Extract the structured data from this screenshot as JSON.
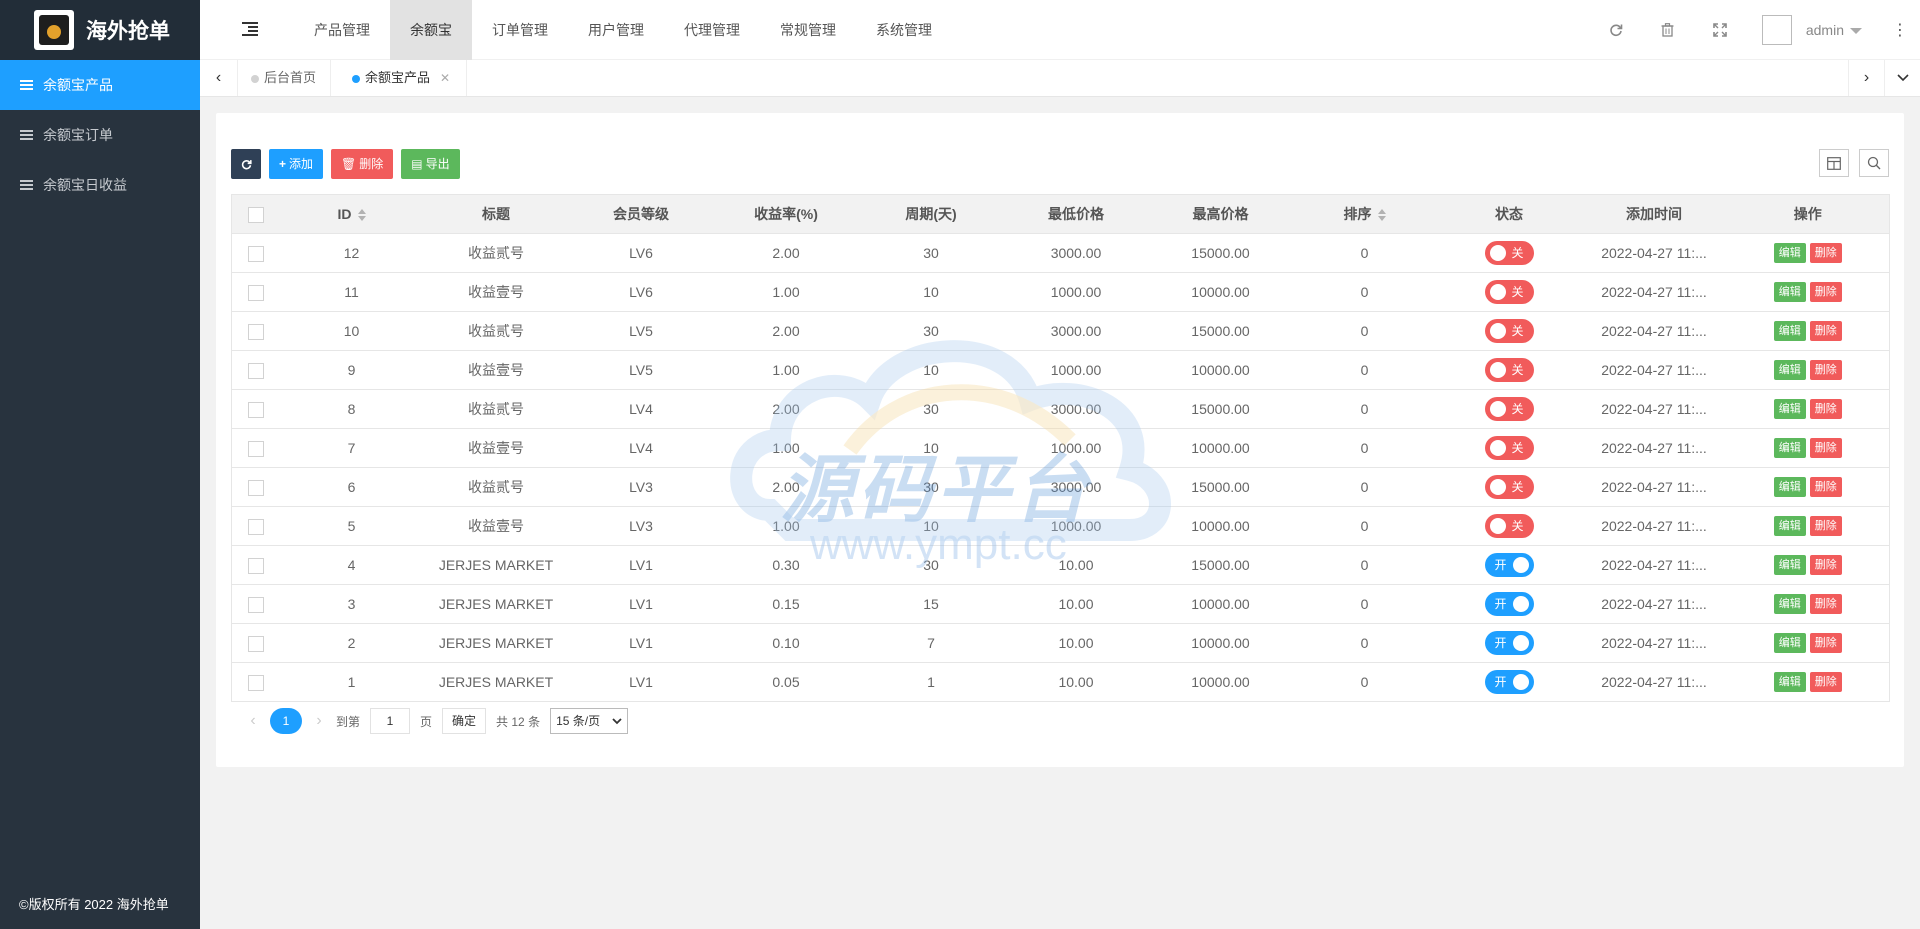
{
  "brand": {
    "title": "海外抢单"
  },
  "sidebar": {
    "items": [
      {
        "label": "余额宝产品",
        "active": true
      },
      {
        "label": "余额宝订单",
        "active": false
      },
      {
        "label": "余额宝日收益",
        "active": false
      }
    ],
    "copyright": "©版权所有 2022 海外抢单"
  },
  "header": {
    "nav": [
      "产品管理",
      "余额宝",
      "订单管理",
      "用户管理",
      "代理管理",
      "常规管理",
      "系统管理"
    ],
    "active_nav": 1,
    "user": "admin"
  },
  "tabs": [
    {
      "label": "后台首页",
      "active": false
    },
    {
      "label": "余额宝产品",
      "active": true
    }
  ],
  "toolbar": {
    "add": "添加",
    "delete": "删除",
    "export": "导出"
  },
  "table": {
    "columns": [
      "ID",
      "标题",
      "会员等级",
      "收益率(%)",
      "周期(天)",
      "最低价格",
      "最高价格",
      "排序",
      "状态",
      "添加时间",
      "操作"
    ],
    "rows": [
      {
        "id": "12",
        "title": "收益贰号",
        "level": "LV6",
        "rate": "2.00",
        "days": "30",
        "min": "3000.00",
        "max": "15000.00",
        "sort": "0",
        "status": "关",
        "on": false,
        "time": "2022-04-27 11:..."
      },
      {
        "id": "11",
        "title": "收益壹号",
        "level": "LV6",
        "rate": "1.00",
        "days": "10",
        "min": "1000.00",
        "max": "10000.00",
        "sort": "0",
        "status": "关",
        "on": false,
        "time": "2022-04-27 11:..."
      },
      {
        "id": "10",
        "title": "收益贰号",
        "level": "LV5",
        "rate": "2.00",
        "days": "30",
        "min": "3000.00",
        "max": "15000.00",
        "sort": "0",
        "status": "关",
        "on": false,
        "time": "2022-04-27 11:..."
      },
      {
        "id": "9",
        "title": "收益壹号",
        "level": "LV5",
        "rate": "1.00",
        "days": "10",
        "min": "1000.00",
        "max": "10000.00",
        "sort": "0",
        "status": "关",
        "on": false,
        "time": "2022-04-27 11:..."
      },
      {
        "id": "8",
        "title": "收益贰号",
        "level": "LV4",
        "rate": "2.00",
        "days": "30",
        "min": "3000.00",
        "max": "15000.00",
        "sort": "0",
        "status": "关",
        "on": false,
        "time": "2022-04-27 11:..."
      },
      {
        "id": "7",
        "title": "收益壹号",
        "level": "LV4",
        "rate": "1.00",
        "days": "10",
        "min": "1000.00",
        "max": "10000.00",
        "sort": "0",
        "status": "关",
        "on": false,
        "time": "2022-04-27 11:..."
      },
      {
        "id": "6",
        "title": "收益贰号",
        "level": "LV3",
        "rate": "2.00",
        "days": "30",
        "min": "3000.00",
        "max": "15000.00",
        "sort": "0",
        "status": "关",
        "on": false,
        "time": "2022-04-27 11:..."
      },
      {
        "id": "5",
        "title": "收益壹号",
        "level": "LV3",
        "rate": "1.00",
        "days": "10",
        "min": "1000.00",
        "max": "10000.00",
        "sort": "0",
        "status": "关",
        "on": false,
        "time": "2022-04-27 11:..."
      },
      {
        "id": "4",
        "title": "JERJES MARKET",
        "level": "LV1",
        "rate": "0.30",
        "days": "30",
        "min": "10.00",
        "max": "15000.00",
        "sort": "0",
        "status": "开",
        "on": true,
        "time": "2022-04-27 11:..."
      },
      {
        "id": "3",
        "title": "JERJES MARKET",
        "level": "LV1",
        "rate": "0.15",
        "days": "15",
        "min": "10.00",
        "max": "10000.00",
        "sort": "0",
        "status": "开",
        "on": true,
        "time": "2022-04-27 11:..."
      },
      {
        "id": "2",
        "title": "JERJES MARKET",
        "level": "LV1",
        "rate": "0.10",
        "days": "7",
        "min": "10.00",
        "max": "10000.00",
        "sort": "0",
        "status": "开",
        "on": true,
        "time": "2022-04-27 11:..."
      },
      {
        "id": "1",
        "title": "JERJES MARKET",
        "level": "LV1",
        "rate": "0.05",
        "days": "1",
        "min": "10.00",
        "max": "10000.00",
        "sort": "0",
        "status": "开",
        "on": true,
        "time": "2022-04-27 11:..."
      }
    ],
    "edit_label": "编辑",
    "delete_label": "删除"
  },
  "pager": {
    "current": "1",
    "goto_prefix": "到第",
    "goto_value": "1",
    "goto_suffix": "页",
    "confirm": "确定",
    "total": "共 12 条",
    "page_size": "15 条/页"
  },
  "watermark": {
    "title": "源码平台",
    "url": "www.ympt.cc"
  },
  "colors": {
    "accent": "#1e9fff",
    "danger": "#f15b5b",
    "success": "#5cb85c",
    "sidebar": "#28333e",
    "dark_button": "#2f4056"
  }
}
